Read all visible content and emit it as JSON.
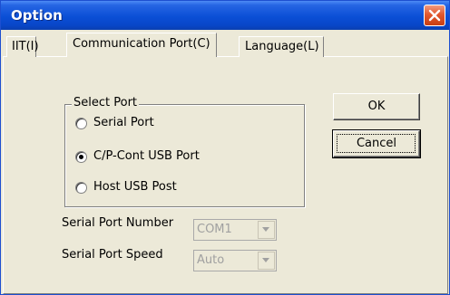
{
  "window": {
    "title": "Option"
  },
  "tabs": [
    {
      "label": "IIT(I)",
      "active": false
    },
    {
      "label": "Communication Port(C)",
      "active": true
    },
    {
      "label": "Language(L)",
      "active": false
    }
  ],
  "select_port": {
    "legend": "Select Port",
    "options": [
      {
        "label": "Serial Port",
        "selected": false
      },
      {
        "label": "C/P-Cont USB Port",
        "selected": true
      },
      {
        "label": "Host USB Post",
        "selected": false
      }
    ]
  },
  "serial_port_number": {
    "label": "Serial Port Number",
    "value": "COM1"
  },
  "serial_port_speed": {
    "label": "Serial Port Speed",
    "value": "Auto"
  },
  "buttons": {
    "ok": "OK",
    "cancel": "Cancel"
  },
  "colors": {
    "titlebar": "#0b4fd6",
    "face": "#ece9d8",
    "close": "#e2582f"
  }
}
